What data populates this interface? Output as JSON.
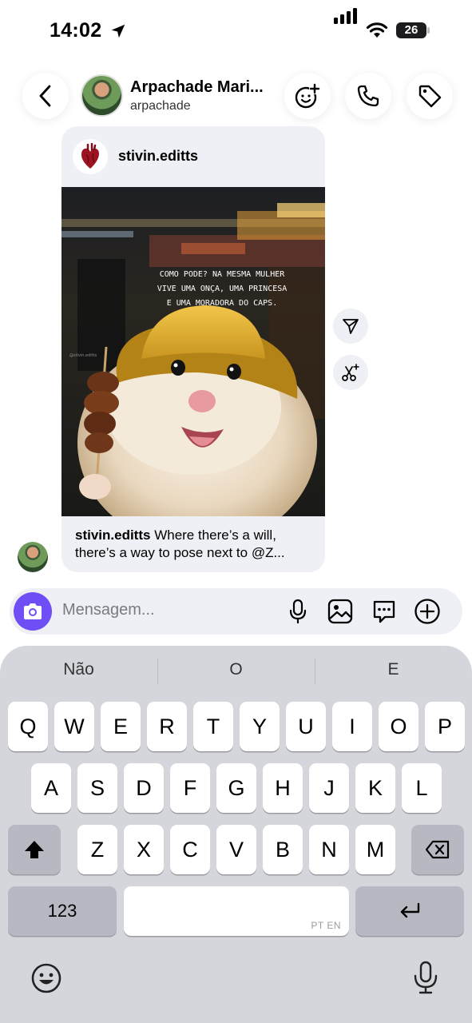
{
  "status_bar": {
    "time": "14:02",
    "battery": "26"
  },
  "header": {
    "name": "Arpachade Mari...",
    "username": "arpachade",
    "icons": [
      "back-chevron-icon",
      "add-emoji-icon",
      "phone-icon",
      "tag-icon"
    ]
  },
  "post": {
    "author": "stivin.editts",
    "overlay_text": [
      "COMO PODE? NA MESMA MULHER",
      "VIVE UMA ONÇA, UMA PRINCESA",
      "E UMA MORADORA DO CAPS."
    ],
    "watermark": "@stivin.editts",
    "caption_user": "stivin.editts",
    "caption_text": " Where there’s a will, there’s a way to pose next to @Z..."
  },
  "composer": {
    "placeholder": "Mensagem...",
    "icons": [
      "camera-icon",
      "microphone-icon",
      "gallery-icon",
      "sticker-icon",
      "plus-icon"
    ]
  },
  "keyboard": {
    "suggestions": [
      "Não",
      "O",
      "E"
    ],
    "row1": [
      "Q",
      "W",
      "E",
      "R",
      "T",
      "Y",
      "U",
      "I",
      "O",
      "P"
    ],
    "row2": [
      "A",
      "S",
      "D",
      "F",
      "G",
      "H",
      "J",
      "K",
      "L"
    ],
    "row3": [
      "Z",
      "X",
      "C",
      "V",
      "B",
      "N",
      "M"
    ],
    "numbers_label": "123",
    "space_lang": "PT EN"
  },
  "colors": {
    "accent": "#6f4ef6",
    "bubble": "#eef0f5",
    "keyboard_bg": "#d4d6dc"
  }
}
